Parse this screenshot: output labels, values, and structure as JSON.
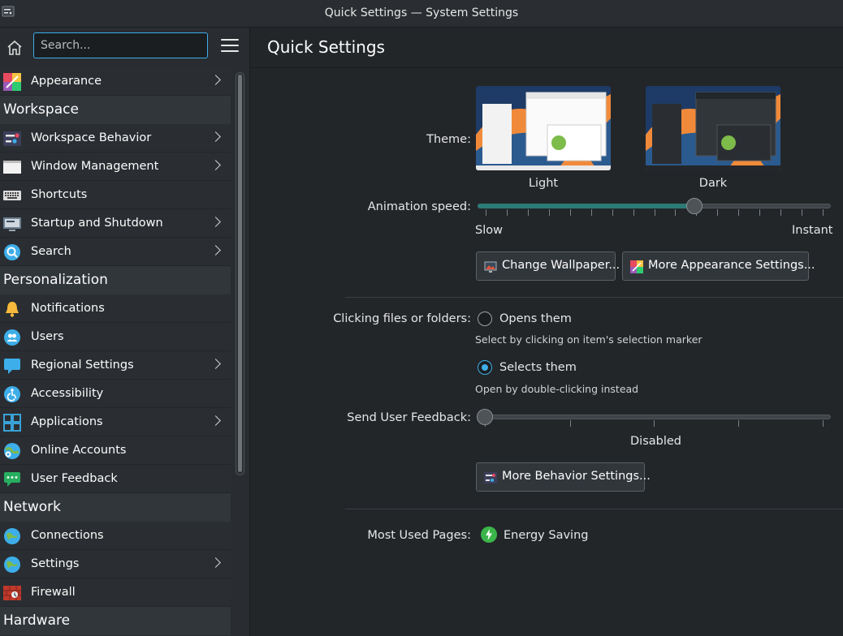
{
  "window": {
    "title": "Quick Settings — System Settings"
  },
  "sidebar": {
    "search_placeholder": "Search...",
    "entries": [
      {
        "kind": "item",
        "label": "Appearance",
        "icon": "appearance-icon",
        "chevron": true
      },
      {
        "kind": "header",
        "label": "Workspace"
      },
      {
        "kind": "item",
        "label": "Workspace Behavior",
        "icon": "workspace-behavior-icon",
        "chevron": true
      },
      {
        "kind": "item",
        "label": "Window Management",
        "icon": "window-management-icon",
        "chevron": true
      },
      {
        "kind": "item",
        "label": "Shortcuts",
        "icon": "keyboard-icon",
        "chevron": false
      },
      {
        "kind": "item",
        "label": "Startup and Shutdown",
        "icon": "startup-icon",
        "chevron": true
      },
      {
        "kind": "item",
        "label": "Search",
        "icon": "search-icon",
        "chevron": true
      },
      {
        "kind": "header",
        "label": "Personalization"
      },
      {
        "kind": "item",
        "label": "Notifications",
        "icon": "bell-icon",
        "chevron": false
      },
      {
        "kind": "item",
        "label": "Users",
        "icon": "users-icon",
        "chevron": false
      },
      {
        "kind": "item",
        "label": "Regional Settings",
        "icon": "regional-icon",
        "chevron": true
      },
      {
        "kind": "item",
        "label": "Accessibility",
        "icon": "accessibility-icon",
        "chevron": false
      },
      {
        "kind": "item",
        "label": "Applications",
        "icon": "applications-icon",
        "chevron": true
      },
      {
        "kind": "item",
        "label": "Online Accounts",
        "icon": "online-accounts-icon",
        "chevron": false
      },
      {
        "kind": "item",
        "label": "User Feedback",
        "icon": "feedback-icon",
        "chevron": false
      },
      {
        "kind": "header",
        "label": "Network"
      },
      {
        "kind": "item",
        "label": "Connections",
        "icon": "globe-icon",
        "chevron": false
      },
      {
        "kind": "item",
        "label": "Settings",
        "icon": "globe-icon",
        "chevron": true
      },
      {
        "kind": "item",
        "label": "Firewall",
        "icon": "firewall-icon",
        "chevron": false
      },
      {
        "kind": "header",
        "label": "Hardware"
      }
    ]
  },
  "main": {
    "title": "Quick Settings",
    "theme": {
      "label": "Theme:",
      "light": "Light",
      "dark": "Dark"
    },
    "animation": {
      "label": "Animation speed:",
      "min_label": "Slow",
      "max_label": "Instant",
      "value_fraction": 0.62
    },
    "buttons": {
      "change_wallpaper": "Change Wallpaper...",
      "more_appearance": "More Appearance Settings..."
    },
    "clicking": {
      "label": "Clicking files or folders:",
      "opens": "Opens them",
      "opens_hint": "Select by clicking on item's selection marker",
      "selects": "Selects them",
      "selects_hint": "Open by double-clicking instead",
      "selected": "selects"
    },
    "feedback": {
      "label": "Send User Feedback:",
      "value_label": "Disabled"
    },
    "more_behavior": "More Behavior Settings...",
    "most_used": {
      "label": "Most Used Pages:",
      "page": "Energy Saving"
    }
  }
}
